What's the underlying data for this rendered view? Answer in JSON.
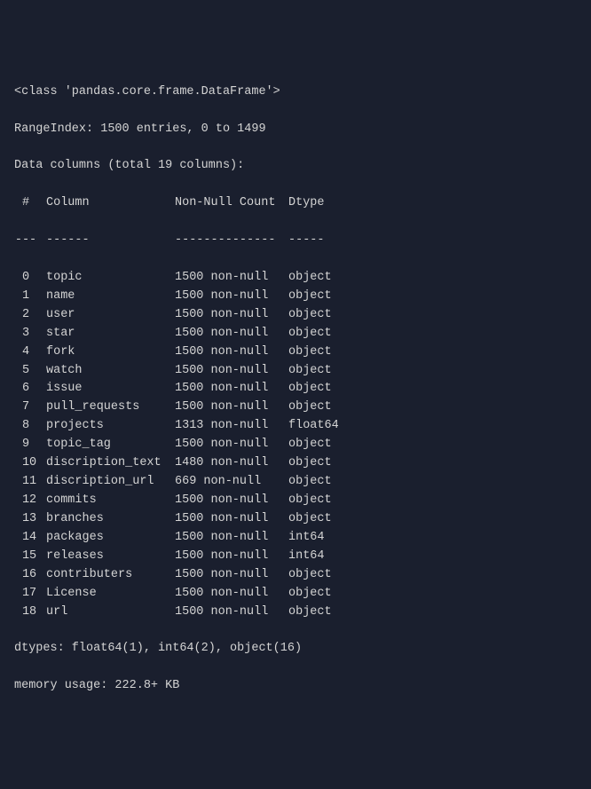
{
  "header": {
    "class_line": "<class 'pandas.core.frame.DataFrame'>",
    "range_index": "RangeIndex: 1500 entries, 0 to 1499",
    "data_columns": "Data columns (total 19 columns):"
  },
  "table_header": {
    "idx_label": " # ",
    "column_label": "Column",
    "count_label": "Non-Null Count",
    "dtype_label": "Dtype"
  },
  "divider": {
    "idx": "---",
    "column": "------",
    "count": "--------------",
    "dtype": "-----"
  },
  "rows": [
    {
      "idx": " 0 ",
      "name": "topic",
      "count": "1500 non-null",
      "dtype": "object"
    },
    {
      "idx": " 1 ",
      "name": "name",
      "count": "1500 non-null",
      "dtype": "object"
    },
    {
      "idx": " 2 ",
      "name": "user",
      "count": "1500 non-null",
      "dtype": "object"
    },
    {
      "idx": " 3 ",
      "name": "star",
      "count": "1500 non-null",
      "dtype": "object"
    },
    {
      "idx": " 4 ",
      "name": "fork",
      "count": "1500 non-null",
      "dtype": "object"
    },
    {
      "idx": " 5 ",
      "name": "watch",
      "count": "1500 non-null",
      "dtype": "object"
    },
    {
      "idx": " 6 ",
      "name": "issue",
      "count": "1500 non-null",
      "dtype": "object"
    },
    {
      "idx": " 7 ",
      "name": "pull_requests",
      "count": "1500 non-null",
      "dtype": "object"
    },
    {
      "idx": " 8 ",
      "name": "projects",
      "count": "1313 non-null",
      "dtype": "float64"
    },
    {
      "idx": " 9 ",
      "name": "topic_tag",
      "count": "1500 non-null",
      "dtype": "object"
    },
    {
      "idx": " 10",
      "name": "discription_text",
      "count": "1480 non-null",
      "dtype": "object"
    },
    {
      "idx": " 11",
      "name": "discription_url",
      "count": "669 non-null",
      "dtype": "object"
    },
    {
      "idx": " 12",
      "name": "commits",
      "count": "1500 non-null",
      "dtype": "object"
    },
    {
      "idx": " 13",
      "name": "branches",
      "count": "1500 non-null",
      "dtype": "object"
    },
    {
      "idx": " 14",
      "name": "packages",
      "count": "1500 non-null",
      "dtype": "int64"
    },
    {
      "idx": " 15",
      "name": "releases",
      "count": "1500 non-null",
      "dtype": "int64"
    },
    {
      "idx": " 16",
      "name": "contributers",
      "count": "1500 non-null",
      "dtype": "object"
    },
    {
      "idx": " 17",
      "name": "License",
      "count": "1500 non-null",
      "dtype": "object"
    },
    {
      "idx": " 18",
      "name": "url",
      "count": "1500 non-null",
      "dtype": "object"
    }
  ],
  "footer": {
    "dtypes": "dtypes: float64(1), int64(2), object(16)",
    "memory": "memory usage: 222.8+ KB"
  }
}
